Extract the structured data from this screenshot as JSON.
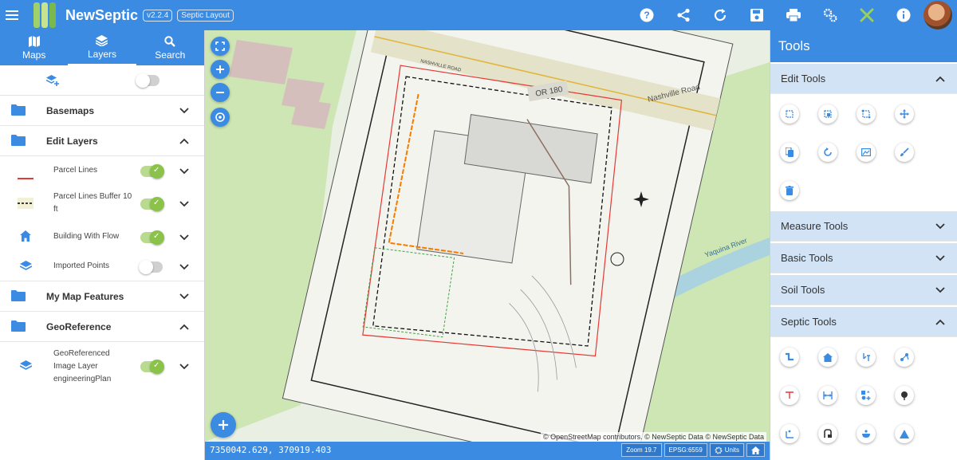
{
  "app": {
    "title": "NewSeptic",
    "version": "v2.2.4",
    "layout": "Septic Layout"
  },
  "topbar_icons": [
    "menu-icon",
    "help-icon",
    "share-icon",
    "refresh-icon",
    "save-icon",
    "print-icon",
    "settings-icon",
    "tools-icon",
    "info-icon",
    "avatar"
  ],
  "left_tabs": [
    {
      "label": "Maps",
      "icon": "map-icon"
    },
    {
      "label": "Layers",
      "icon": "layers-icon",
      "active": true
    },
    {
      "label": "Search",
      "icon": "search-icon"
    }
  ],
  "layers": {
    "groups": [
      {
        "label": "Basemaps",
        "expanded": false
      },
      {
        "label": "Edit Layers",
        "expanded": true,
        "items": [
          {
            "label": "Parcel Lines",
            "on": true
          },
          {
            "label": "Parcel Lines Buffer 10 ft",
            "on": true
          },
          {
            "label": "Building With Flow",
            "on": true
          },
          {
            "label": "Imported Points",
            "on": false
          }
        ]
      },
      {
        "label": "My Map Features",
        "expanded": false
      },
      {
        "label": "GeoReference",
        "expanded": true,
        "items": [
          {
            "label": "GeoReferenced Image Layer engineeringPlan",
            "on": true
          }
        ]
      }
    ]
  },
  "map": {
    "labels": {
      "road1": "NASHVILLE ROAD",
      "road2": "Nashville Road",
      "route": "OR 180",
      "river": "Yaquina River"
    },
    "attribution": "© OpenStreetMap contributors. © NewSeptic Data © NewSeptic Data",
    "coords": "7350042.629, 370919.403",
    "zoom": "Zoom 19.7",
    "epsg": "EPSG:6559",
    "units": "Units"
  },
  "tools": {
    "title": "Tools",
    "sections": [
      {
        "label": "Edit Tools",
        "expanded": true
      },
      {
        "label": "Measure Tools",
        "expanded": false
      },
      {
        "label": "Basic Tools",
        "expanded": false
      },
      {
        "label": "Soil Tools",
        "expanded": false
      },
      {
        "label": "Septic Tools",
        "expanded": true
      }
    ]
  },
  "colors": {
    "primary": "#3b8be2",
    "section_bg": "#d2e3f6",
    "toggle_on": "#8bc34a",
    "map_green": "#cde6b3",
    "river": "#aad3df"
  }
}
